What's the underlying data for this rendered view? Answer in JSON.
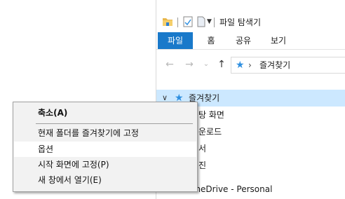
{
  "window": {
    "title": "파일 탐색기"
  },
  "quick_access": {
    "folder_icon": "folder-icon",
    "properties_icon": "properties-check-icon",
    "new_folder_icon": "new-document-icon",
    "customize_icon": "dropdown-arrow-icon"
  },
  "ribbon": {
    "tabs": [
      {
        "label": "파일",
        "active": true
      },
      {
        "label": "홈"
      },
      {
        "label": "공유"
      },
      {
        "label": "보기"
      }
    ],
    "active_color": "#1979ca"
  },
  "address_bar": {
    "back_icon": "←",
    "forward_icon": "→",
    "recent_icon": "⌄",
    "up_icon": "↑",
    "path": "즐겨찾기"
  },
  "tree": {
    "favorites": "즐겨찾기",
    "items": [
      "탕 화면",
      "운로드",
      "서",
      "진"
    ],
    "onedrive": "OneDrive - Personal",
    "selected_color": "#cce8ff"
  },
  "context_menu": {
    "items": [
      {
        "label": "축소(A)",
        "bold": true
      },
      {
        "label": "현재 폴더를 즐겨찾기에 고정"
      },
      {
        "label": "옵션",
        "hover": true
      },
      {
        "label": "시작 화면에 고정(P)"
      },
      {
        "label": "새 창에서 열기(E)"
      }
    ]
  }
}
